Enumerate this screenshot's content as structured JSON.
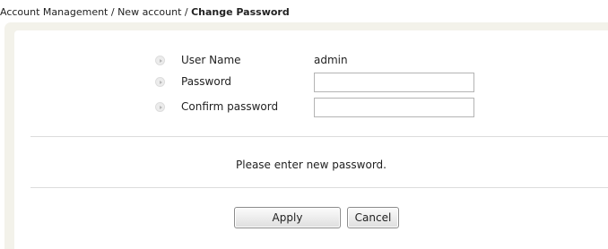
{
  "breadcrumb": {
    "part1": "Account Management",
    "sep1": " / ",
    "part2": "New account",
    "sep2": " / ",
    "current": "Change Password"
  },
  "form": {
    "username": {
      "label": "User Name",
      "value": "admin"
    },
    "password": {
      "label": "Password",
      "value": ""
    },
    "confirm": {
      "label": "Confirm password",
      "value": ""
    }
  },
  "message": "Please enter new password.",
  "buttons": {
    "apply": "Apply",
    "cancel": "Cancel"
  },
  "icons": {
    "bullet": "circle-arrow-right-icon"
  },
  "colors": {
    "frame_background": "#f3f2ea",
    "panel_background": "#ffffff",
    "divider": "#dcdcdc"
  }
}
